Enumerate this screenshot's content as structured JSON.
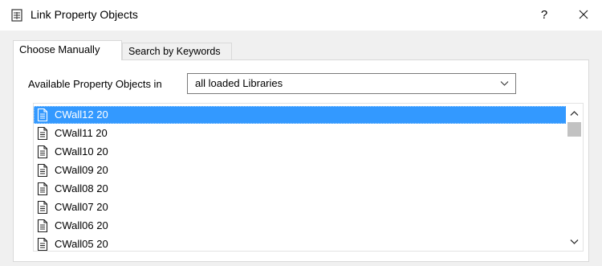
{
  "window": {
    "title": "Link Property Objects",
    "title_icon": "document-table-icon",
    "help_label": "?",
    "close_icon": "close-icon"
  },
  "tabs": [
    {
      "label": "Choose Manually",
      "active": true
    },
    {
      "label": "Search by Keywords",
      "active": false
    }
  ],
  "available": {
    "label": "Available Property Objects in",
    "selected": "all loaded Libraries",
    "arrow_icon": "chevron-down-icon"
  },
  "list": {
    "item_icon": "document-icon",
    "selected_index": 0,
    "items": [
      "CWall12 20",
      "CWall11 20",
      "CWall10 20",
      "CWall09 20",
      "CWall08 20",
      "CWall07 20",
      "CWall06 20",
      "CWall05 20"
    ]
  },
  "colors": {
    "selection": "#3399ff",
    "dialog_bg": "#f0f0f0",
    "scroll_thumb": "#c2c2c2"
  }
}
